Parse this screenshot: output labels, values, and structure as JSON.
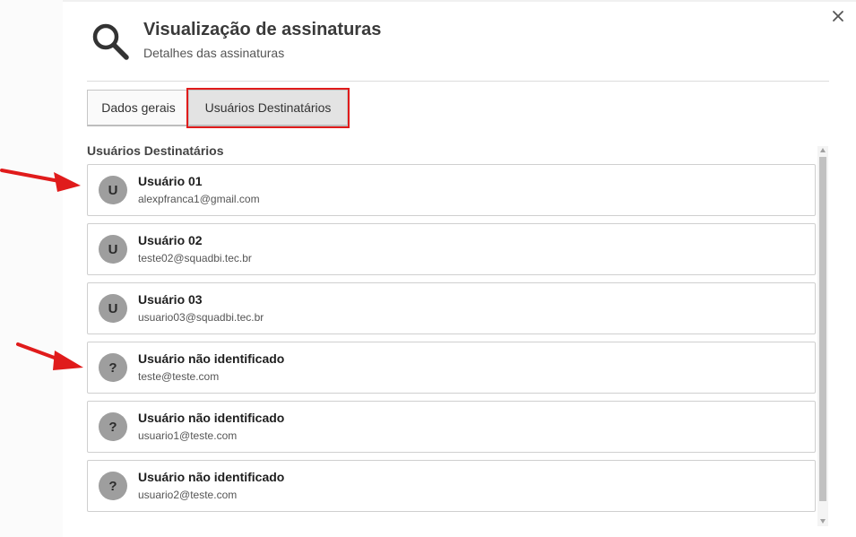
{
  "dialog": {
    "title": "Visualização de assinaturas",
    "subtitle": "Detalhes das assinaturas",
    "close_icon": "close-icon",
    "header_icon": "search-icon"
  },
  "tabs": [
    {
      "label": "Dados gerais",
      "active": false
    },
    {
      "label": "Usuários Destinatários",
      "active": true,
      "highlighted": true
    }
  ],
  "section": {
    "label": "Usuários Destinatários"
  },
  "recipients": [
    {
      "initial": "U",
      "name": "Usuário 01",
      "email": "alexpfranca1@gmail.com",
      "annotated": true
    },
    {
      "initial": "U",
      "name": "Usuário 02",
      "email": "teste02@squadbi.tec.br",
      "annotated": false
    },
    {
      "initial": "U",
      "name": "Usuário 03",
      "email": "usuario03@squadbi.tec.br",
      "annotated": false
    },
    {
      "initial": "?",
      "name": "Usuário não identificado",
      "email": "teste@teste.com",
      "annotated": true
    },
    {
      "initial": "?",
      "name": "Usuário não identificado",
      "email": "usuario1@teste.com",
      "annotated": false
    },
    {
      "initial": "?",
      "name": "Usuário não identificado",
      "email": "usuario2@teste.com",
      "annotated": false
    }
  ],
  "colors": {
    "annotation_red": "#e01b1b",
    "avatar_gray": "#9e9e9e"
  }
}
